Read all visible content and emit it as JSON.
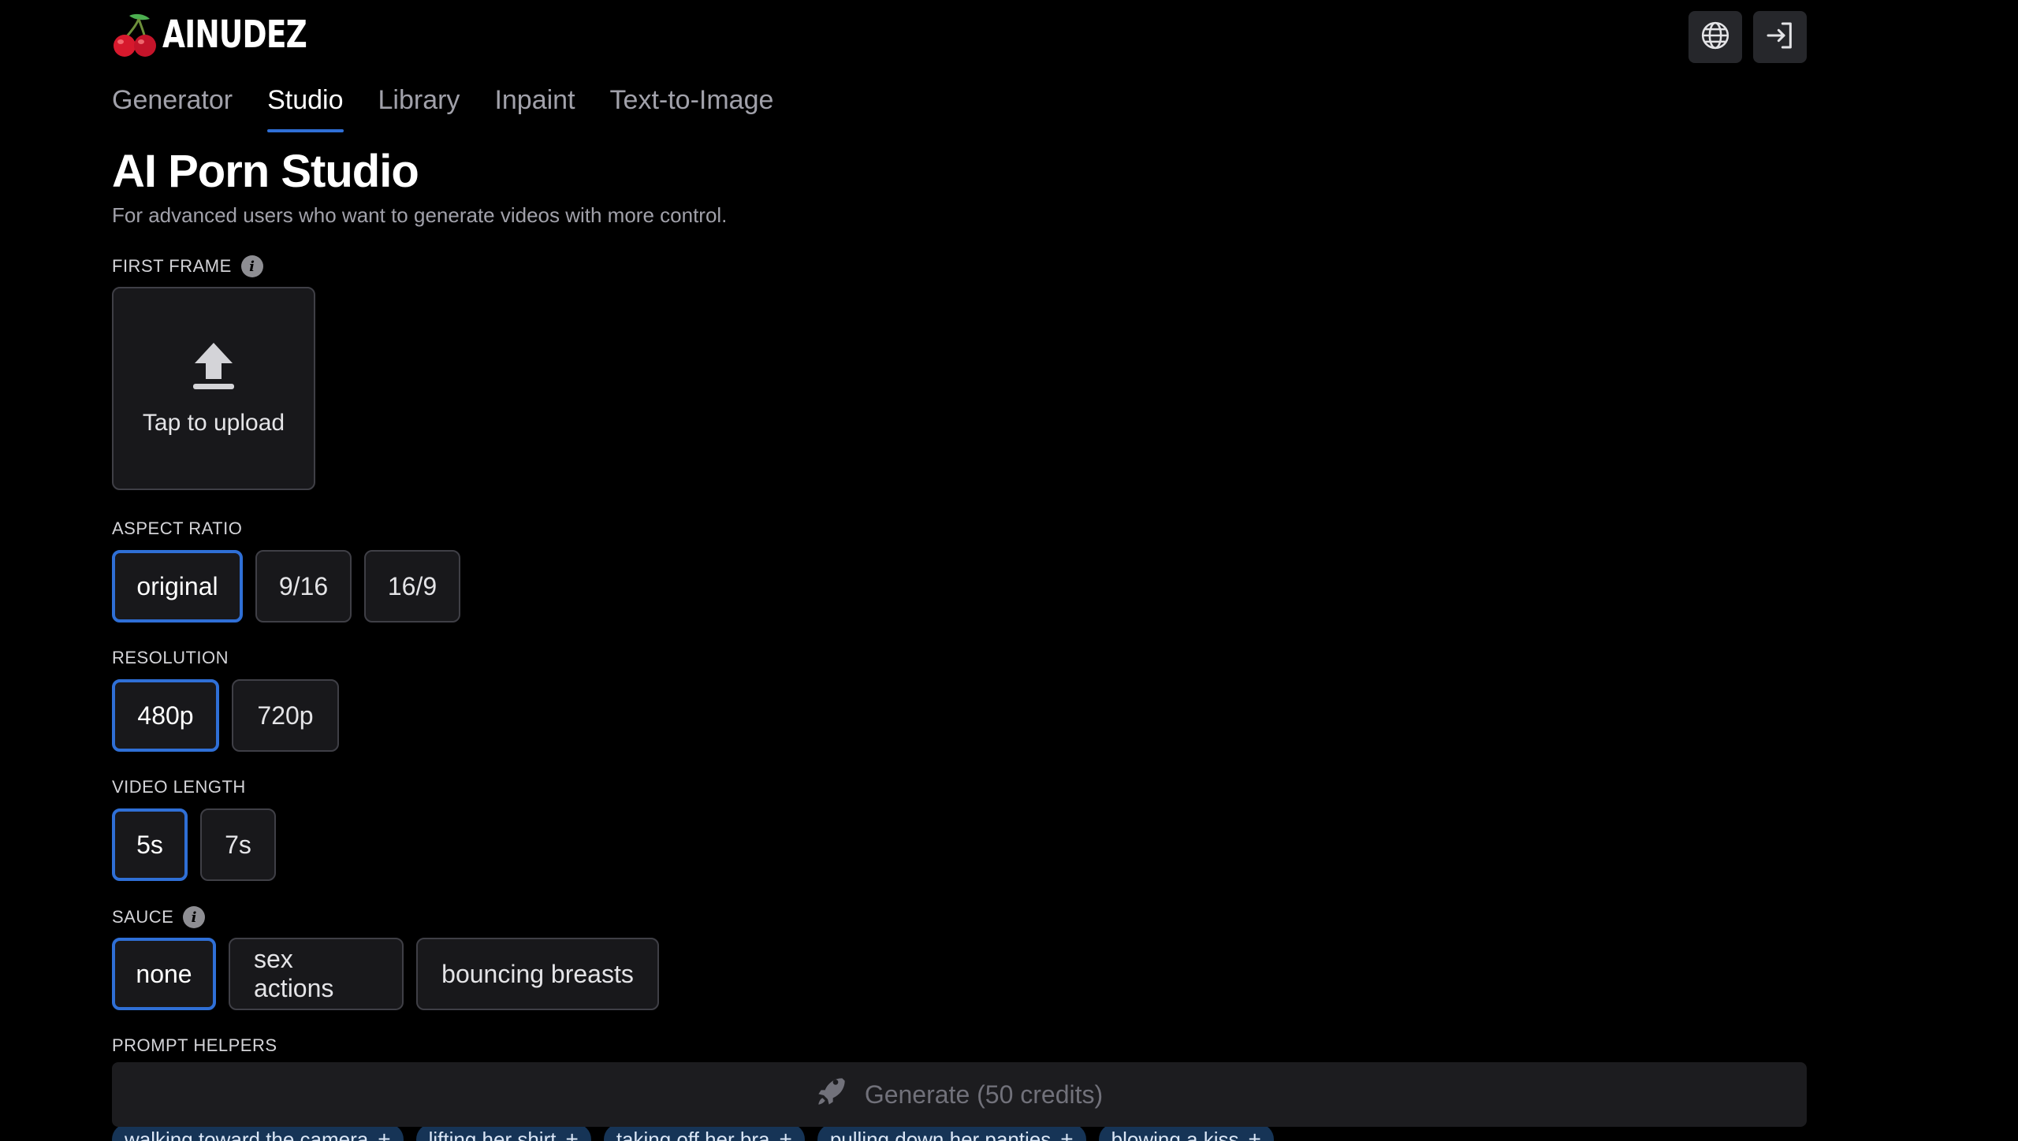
{
  "brand": {
    "name": "AINUDEZ",
    "logo_icon": "cherry-icon"
  },
  "header": {
    "globe_icon": "globe-icon",
    "login_icon": "login-icon"
  },
  "nav": {
    "tabs": [
      {
        "label": "Generator",
        "active": false
      },
      {
        "label": "Studio",
        "active": true
      },
      {
        "label": "Library",
        "active": false
      },
      {
        "label": "Inpaint",
        "active": false
      },
      {
        "label": "Text-to-Image",
        "active": false
      }
    ]
  },
  "page": {
    "title": "AI Porn Studio",
    "subtitle": "For advanced users who want to generate videos with more control."
  },
  "first_frame": {
    "label": "FIRST FRAME",
    "upload_text": "Tap to upload"
  },
  "aspect_ratio": {
    "label": "ASPECT RATIO",
    "options": [
      "original",
      "9/16",
      "16/9"
    ],
    "selected": "original"
  },
  "resolution": {
    "label": "RESOLUTION",
    "options": [
      "480p",
      "720p"
    ],
    "selected": "480p"
  },
  "video_length": {
    "label": "VIDEO LENGTH",
    "options": [
      "5s",
      "7s"
    ],
    "selected": "5s"
  },
  "sauce": {
    "label": "SAUCE",
    "options": [
      "none",
      "sex actions",
      "bouncing breasts"
    ],
    "selected": "none"
  },
  "prompt_helpers": {
    "label": "PROMPT HELPERS",
    "chips": [
      "walking toward the camera",
      "lifting her shirt",
      "taking off her bra",
      "pulling down her panties",
      "blowing a kiss"
    ],
    "chip_suffix": "+"
  },
  "generate": {
    "label": "Generate (50 credits)"
  },
  "colors": {
    "accent": "#2f6fd6",
    "background": "#000000",
    "surface": "#18181b",
    "chip": "#163456"
  }
}
